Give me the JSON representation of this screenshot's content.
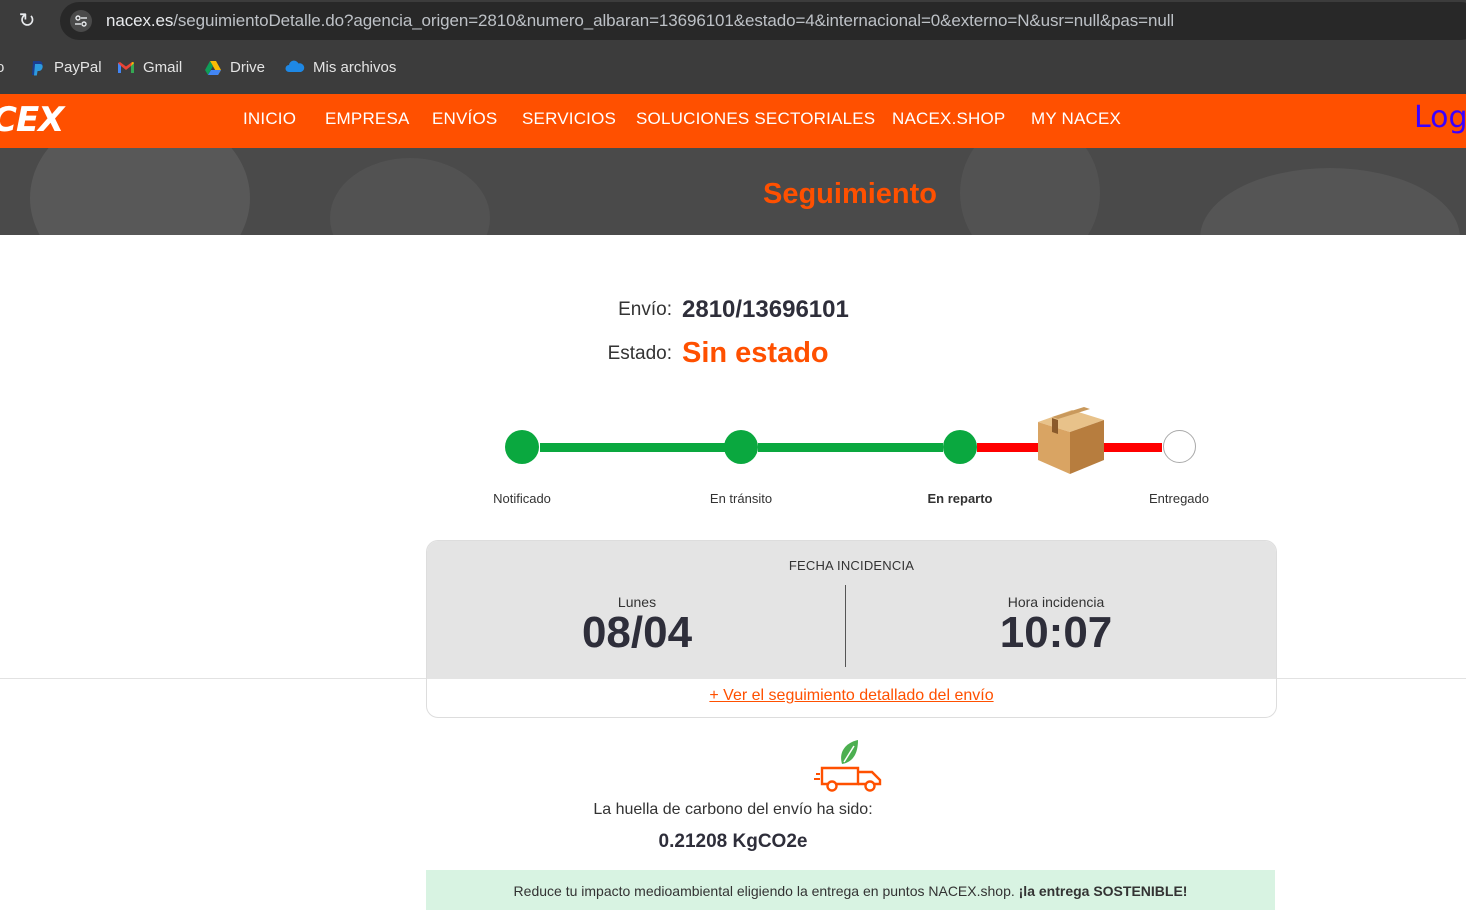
{
  "browser": {
    "url_host": "nacex.es",
    "url_path": "/seguimientoDetalle.do?agencia_origen=2810&numero_albaran=13696101&estado=4&internacional=0&externo=N&usr=null&pas=null",
    "bookmarks": [
      {
        "label": "PayPal",
        "icon": "paypal-icon"
      },
      {
        "label": "Gmail",
        "icon": "gmail-icon"
      },
      {
        "label": "Drive",
        "icon": "drive-icon"
      },
      {
        "label": "Mis archivos",
        "icon": "onedrive-icon"
      }
    ]
  },
  "nav": {
    "logo": "CEX",
    "items": [
      "INICIO",
      "EMPRESA",
      "ENVÍOS",
      "SERVICIOS",
      "SOLUCIONES SECTORIALES",
      "NACEX.SHOP",
      "MY NACEX"
    ],
    "login": "Log"
  },
  "hero": {
    "title": "Seguimiento"
  },
  "shipment": {
    "envio_label": "Envío:",
    "envio_value": "2810/13696101",
    "estado_label": "Estado:",
    "estado_value": "Sin estado"
  },
  "progress": {
    "steps": [
      "Notificado",
      "En tránsito",
      "En reparto",
      "Entregado"
    ],
    "current_step": "En reparto",
    "colors": {
      "done": "#0aa83f",
      "pending": "#ff0000"
    }
  },
  "incidencia": {
    "title": "FECHA INCIDENCIA",
    "day_label": "Lunes",
    "date": "08/04",
    "hora_label": "Hora incidencia",
    "hora": "10:07",
    "detail_link": "+ Ver el seguimiento detallado del envío"
  },
  "carbon": {
    "text": "La huella de carbono del envío ha sido:",
    "value": "0.21208 KgCO2e"
  },
  "banner": {
    "text_pre": "Reduce tu impacto medioambiental eligiendo la entrega en puntos NACEX.shop.",
    "text_bold": "¡la entrega SOSTENIBLE!"
  },
  "colors": {
    "brand": "#ff5000",
    "hero_bg": "#4a4a4a",
    "login": "#3b00ff"
  }
}
